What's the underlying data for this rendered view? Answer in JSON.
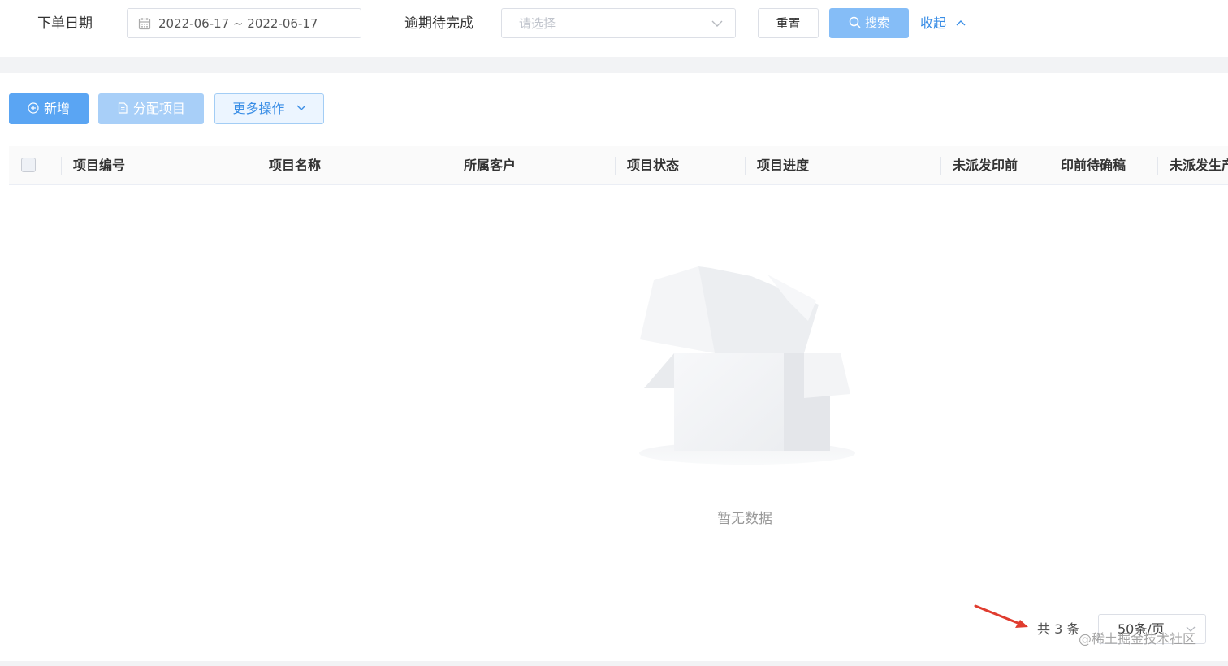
{
  "filters": {
    "order_date_label": "下单日期",
    "date_range": "2022-06-17 ~ 2022-06-17",
    "overdue_label": "逾期待完成",
    "overdue_placeholder": "请选择",
    "reset_label": "重置",
    "search_label": "搜索",
    "collapse_label": "收起"
  },
  "toolbar": {
    "add_label": "新增",
    "assign_label": "分配项目",
    "more_label": "更多操作"
  },
  "table": {
    "columns": [
      "项目编号",
      "项目名称",
      "所属客户",
      "项目状态",
      "项目进度",
      "未派发印前",
      "印前待确稿",
      "未派发生产"
    ],
    "empty_text": "暂无数据"
  },
  "pagination": {
    "total_text": "共 3 条",
    "page_size": "50条/页"
  },
  "watermark": "@稀土掘金技术社区",
  "colors": {
    "primary": "#5aa5f3",
    "primary_light": "#85bdf7",
    "disabled": "#a8cff8",
    "link": "#3a8ee6",
    "annotation_arrow": "#e03c2f"
  },
  "icons": {
    "date": "calendar-icon",
    "select": "chevron-down-icon",
    "search": "search-icon",
    "collapse": "chevron-up-icon",
    "add": "plus-circle-icon",
    "assign": "document-icon",
    "more": "chevron-down-icon",
    "empty": "empty-box-illustration"
  }
}
